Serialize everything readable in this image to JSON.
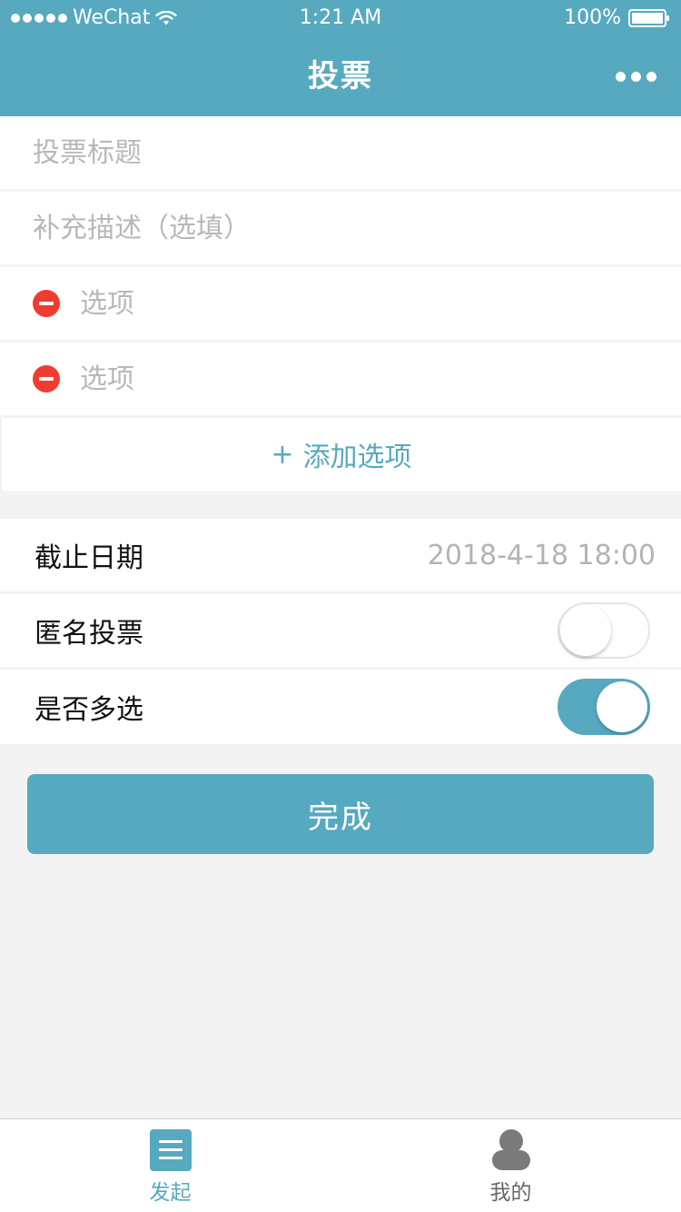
{
  "status_bar": {
    "carrier": "WeChat",
    "time": "1:21 AM",
    "battery": "100%"
  },
  "nav": {
    "title": "投票"
  },
  "form": {
    "title_placeholder": "投票标题",
    "description_placeholder": "补充描述（选填）",
    "options": [
      {
        "placeholder": "选项"
      },
      {
        "placeholder": "选项"
      }
    ],
    "add_option_plus": "+",
    "add_option_label": "添加选项"
  },
  "settings": {
    "deadline_label": "截止日期",
    "deadline_value": "2018-4-18 18:00",
    "anonymous_label": "匿名投票",
    "anonymous_on": false,
    "multi_label": "是否多选",
    "multi_on": true
  },
  "done_label": "完成",
  "tabs": [
    {
      "label": "发起",
      "icon": "list-icon",
      "active": true
    },
    {
      "label": "我的",
      "icon": "user-icon",
      "active": false
    }
  ],
  "colors": {
    "accent": "#57a9bf",
    "remove": "#f03c2f"
  }
}
